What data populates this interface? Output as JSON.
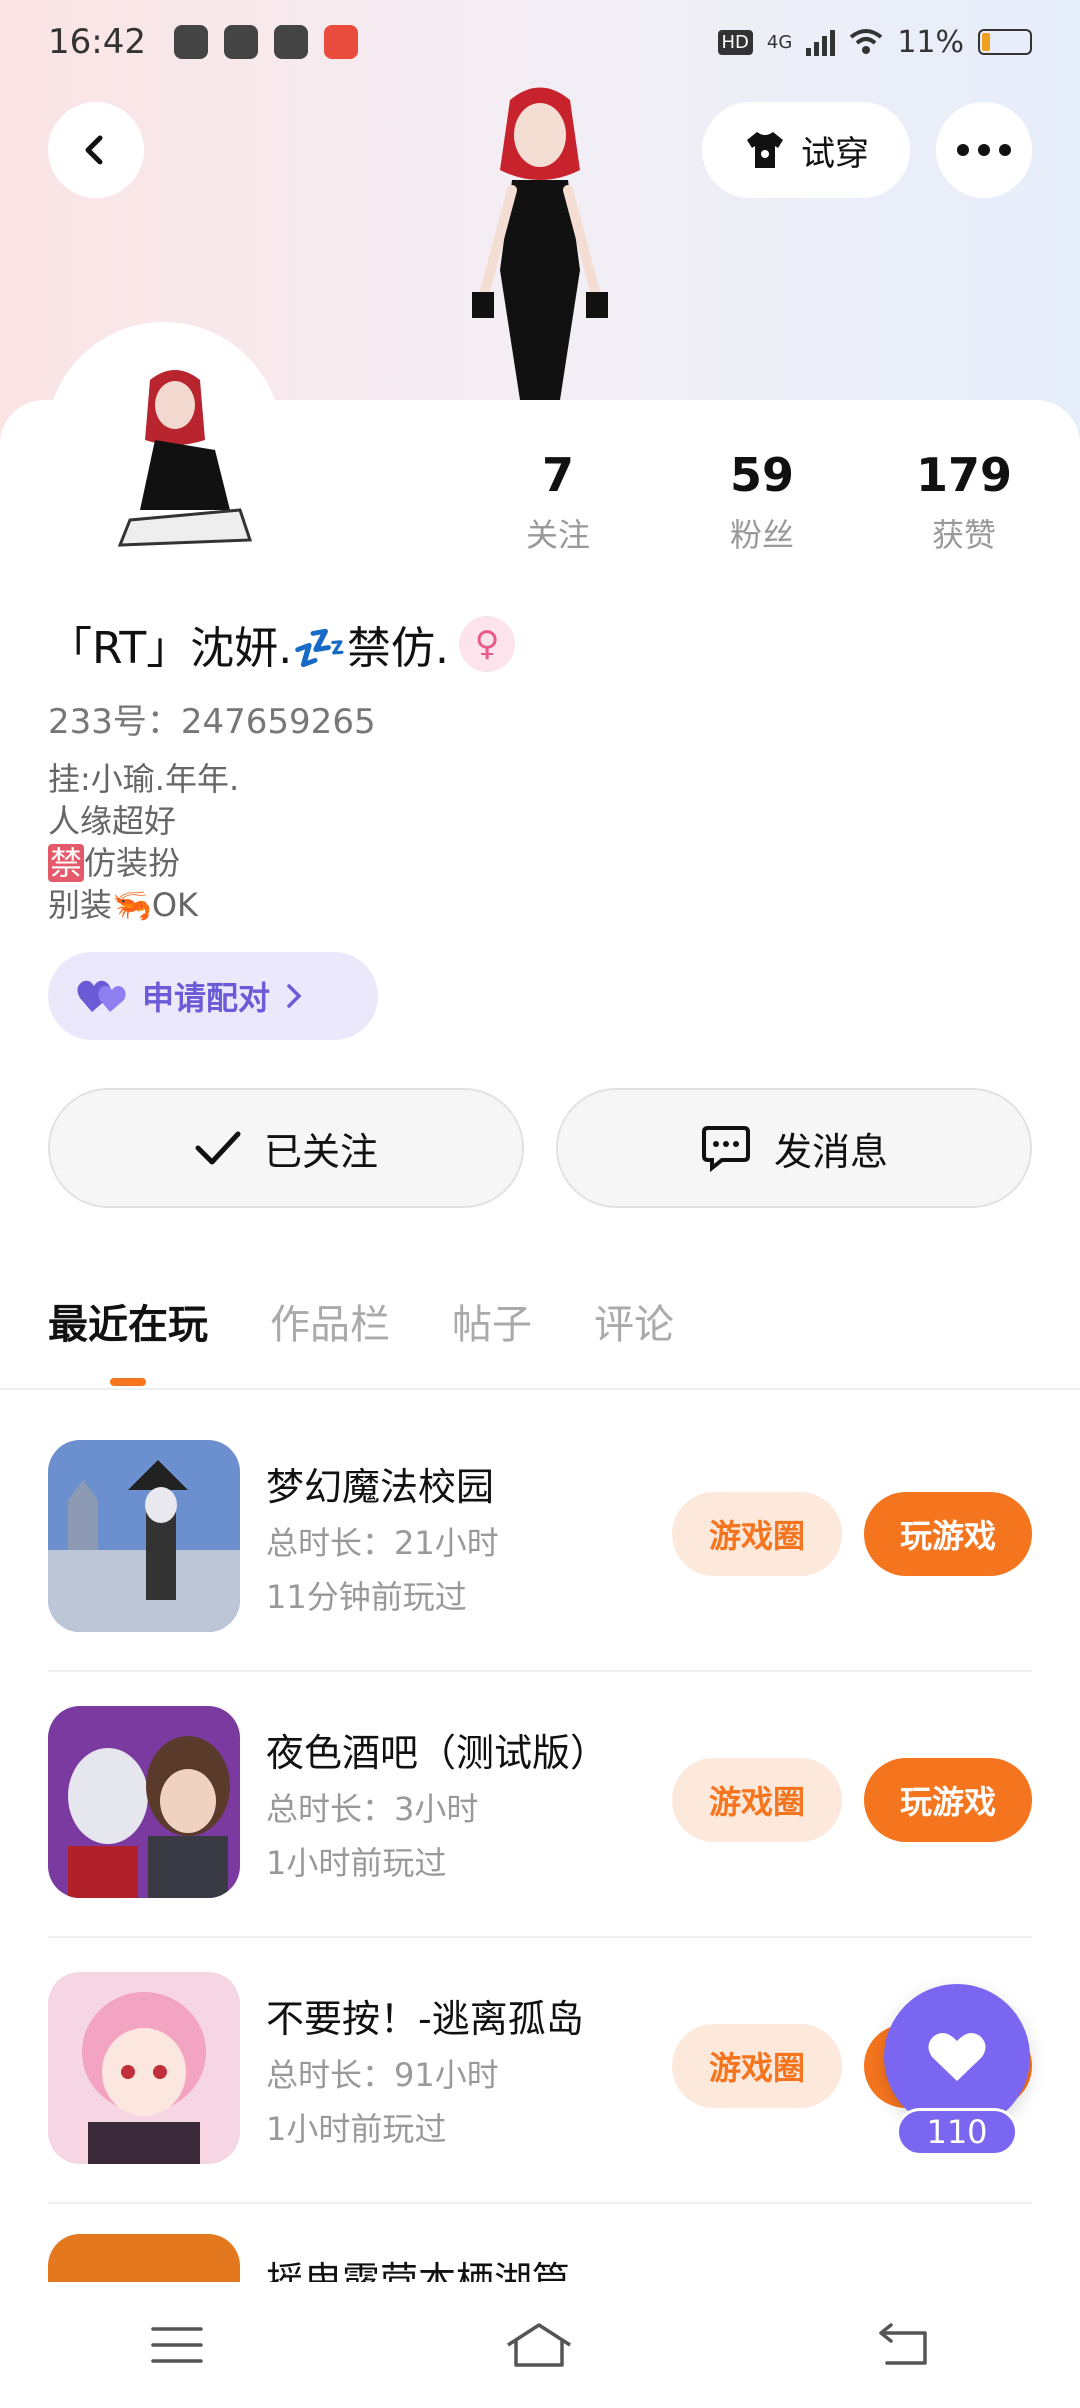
{
  "status_bar": {
    "time": "16:42",
    "network_badge": "HD",
    "network_type": "4G",
    "battery": "11%"
  },
  "header": {
    "try_on_label": "试穿"
  },
  "profile": {
    "stats": [
      {
        "value": "7",
        "label": "关注"
      },
      {
        "value": "59",
        "label": "粉丝"
      },
      {
        "value": "179",
        "label": "获赞"
      }
    ],
    "name": "「RT」沈妍.💤禁仿.",
    "gender_symbol": "♀",
    "uid": "233号：247659265",
    "bio_lines": [
      "挂:小瑜.年年.",
      "人缘超好",
      "仿装扮",
      "别装🦐OK"
    ],
    "bio_ban_tag": "禁",
    "pair_label": "申请配对",
    "follow_label": "已关注",
    "message_label": "发消息"
  },
  "tabs": [
    {
      "label": "最近在玩",
      "active": true
    },
    {
      "label": "作品栏",
      "active": false
    },
    {
      "label": "帖子",
      "active": false
    },
    {
      "label": "评论",
      "active": false
    }
  ],
  "games": [
    {
      "title": "梦幻魔法校园",
      "duration": "总时长：21小时",
      "last_played": "11分钟前玩过",
      "circle_label": "游戏圈",
      "play_label": "玩游戏"
    },
    {
      "title": "夜色酒吧（测试版）",
      "duration": "总时长：3小时",
      "last_played": "1小时前玩过",
      "circle_label": "游戏圈",
      "play_label": "玩游戏"
    },
    {
      "title": "不要按！-逃离孤岛",
      "duration": "总时长：91小时",
      "last_played": "1小时前玩过",
      "circle_label": "游戏圈",
      "play_label": "玩游戏"
    },
    {
      "title": "摇曳露营本栖湖篇",
      "duration": "",
      "last_played": "",
      "circle_label": "",
      "play_label": ""
    }
  ],
  "floating_like": {
    "count": "110"
  },
  "colors": {
    "accent_orange": "#f5751f",
    "accent_purple": "#7a66f0",
    "pair_bg": "#ece8fb"
  }
}
